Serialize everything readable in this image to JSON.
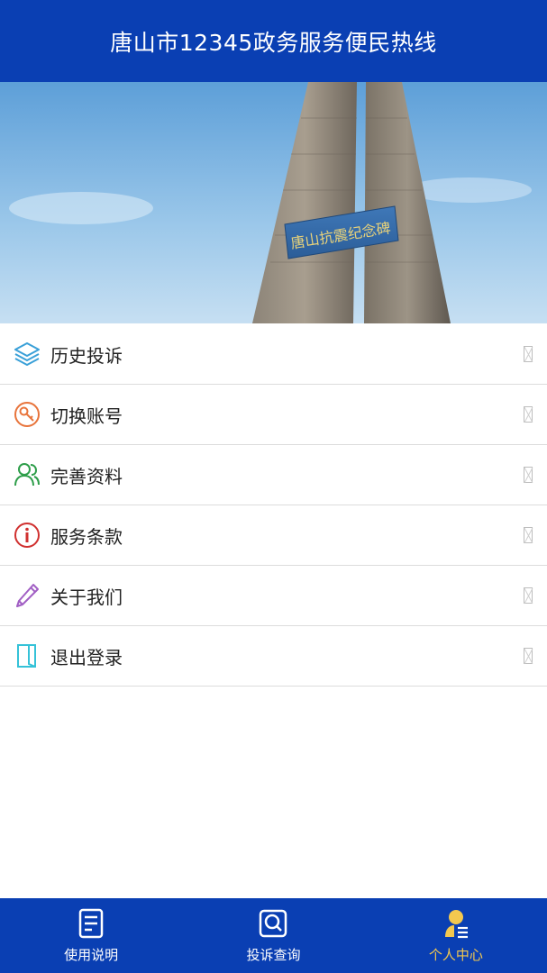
{
  "header": {
    "title": "唐山市12345政务服务便民热线"
  },
  "banner": {
    "monument_inscription": "唐山抗震纪念碑"
  },
  "menu": {
    "items": [
      {
        "label": "历史投诉",
        "icon": "layers-icon",
        "color": "#3aa0d8"
      },
      {
        "label": "切换账号",
        "icon": "key-icon",
        "color": "#e8743b"
      },
      {
        "label": "完善资料",
        "icon": "users-icon",
        "color": "#2e9e4a"
      },
      {
        "label": "服务条款",
        "icon": "info-icon",
        "color": "#d0302f"
      },
      {
        "label": "关于我们",
        "icon": "pencil-icon",
        "color": "#a15fc4"
      },
      {
        "label": "退出登录",
        "icon": "logout-icon",
        "color": "#35c2d8"
      }
    ]
  },
  "tabbar": {
    "tabs": [
      {
        "label": "使用说明",
        "icon": "document-icon",
        "active": false
      },
      {
        "label": "投诉查询",
        "icon": "search-icon",
        "active": false
      },
      {
        "label": "个人中心",
        "icon": "profile-icon",
        "active": true
      }
    ],
    "active_color": "#f3c84f",
    "background": "#0a3fb3"
  }
}
